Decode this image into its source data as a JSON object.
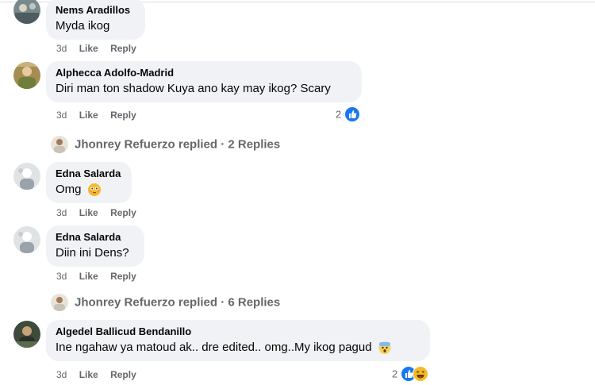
{
  "comments": [
    {
      "name": "Nems Aradillos",
      "text": "Myda ikog",
      "time": "3d",
      "like": "Like",
      "reply": "Reply"
    },
    {
      "name": "Alphecca Adolfo-Madrid",
      "text": "Diri man ton shadow Kuya ano kay may ikog? Scary",
      "time": "3d",
      "like": "Like",
      "reply": "Reply",
      "reactions": "2"
    },
    {
      "name": "Edna Salarda",
      "text": "Omg",
      "time": "3d",
      "like": "Like",
      "reply": "Reply"
    },
    {
      "name": "Edna Salarda",
      "text": "Diin ini Dens?",
      "time": "3d",
      "like": "Like",
      "reply": "Reply"
    },
    {
      "name": "Algedel Ballicud Bendanillo",
      "text": "Ine ngahaw ya matoud ak.. dre edited.. omg..My ikog pagud",
      "time": "3d",
      "like": "Like",
      "reply": "Reply",
      "reactions": "2"
    }
  ],
  "reply_threads": [
    {
      "label": "Jhonrey Refuerzo replied · 2 Replies"
    },
    {
      "label": "Jhonrey Refuerzo replied · 6 Replies"
    }
  ],
  "icons": {
    "like": "like-reaction-icon",
    "haha": "haha-reaction-icon",
    "flushed": "flushed-face-emoji-icon",
    "scream": "screaming-face-emoji-icon"
  },
  "colors": {
    "bubble": "#f0f2f5",
    "meta": "#65676b",
    "like_blue": "#1877f2",
    "emoji_yellow": "#f7b928"
  }
}
